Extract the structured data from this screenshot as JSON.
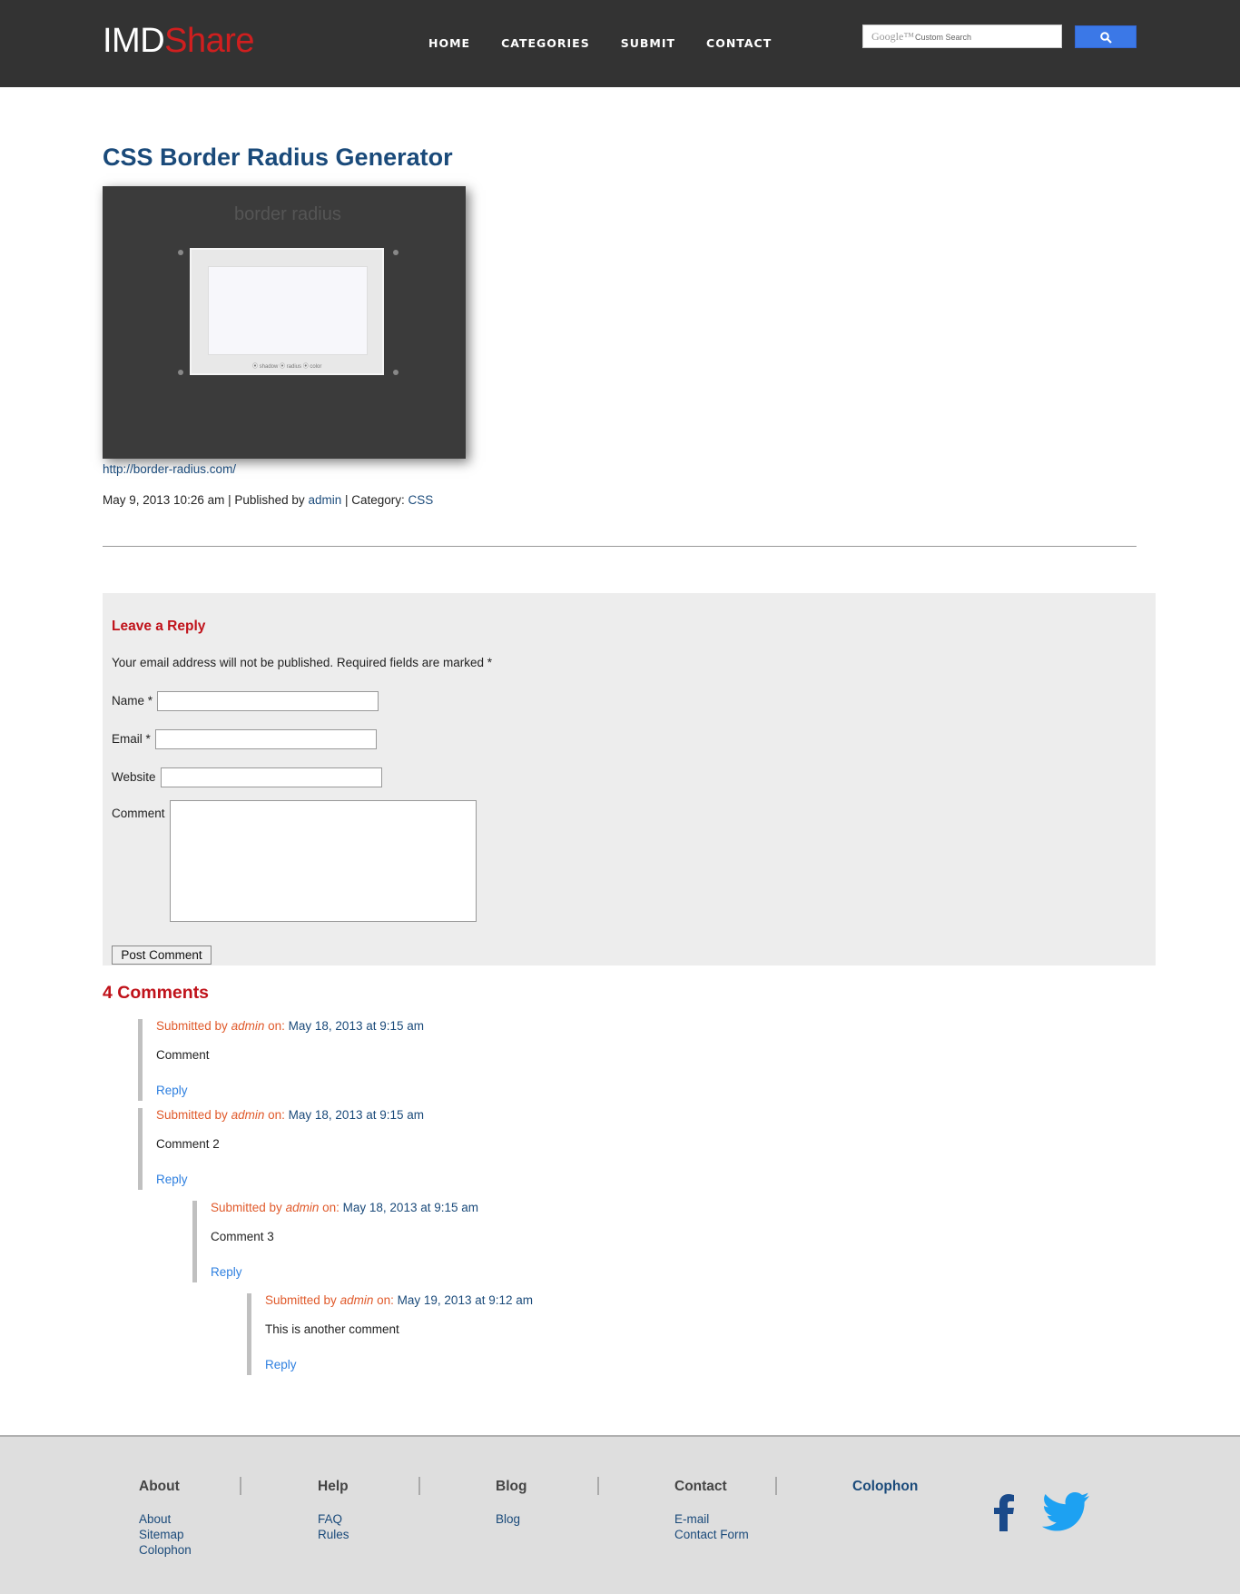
{
  "header": {
    "logo_part1": "IMD",
    "logo_part2": "Share",
    "nav": [
      "HOME",
      "CATEGORIES",
      "SUBMIT",
      "CONTACT"
    ],
    "search": {
      "google_label": "Google™",
      "placeholder": "Custom Search"
    }
  },
  "post": {
    "title": "CSS Border Radius Generator",
    "thumbnail_watermark": "border radius",
    "thumbnail_caption": "⦿ shadow ⦿ radius ⦿ color",
    "link": "http://border-radius.com/",
    "date": "May 9, 2013 10:26 am",
    "published_by_label": "| Published by",
    "author": "admin",
    "category_label": "| Category:",
    "category": "CSS"
  },
  "reply_form": {
    "title": "Leave a Reply",
    "note": "Your email address will not be published. Required fields are marked *",
    "name_label": "Name *",
    "email_label": "Email *",
    "website_label": "Website",
    "comment_label": "Comment",
    "submit": "Post Comment"
  },
  "comments": {
    "title": "4 Comments",
    "submitted_label": "Submitted by",
    "on_label": "on:",
    "reply_label": "Reply",
    "items": [
      {
        "author": "admin",
        "date": "May 18, 2013 at 9:15 am",
        "text": "Comment"
      },
      {
        "author": "admin",
        "date": "May 18, 2013 at 9:15 am",
        "text": "Comment 2"
      },
      {
        "author": "admin",
        "date": "May 18, 2013 at 9:15 am",
        "text": "Comment 3"
      },
      {
        "author": "admin",
        "date": "May 19, 2013 at 9:12 am",
        "text": "This is another comment"
      }
    ]
  },
  "footer": {
    "columns": [
      {
        "heading": "About",
        "links": [
          "About",
          "Sitemap",
          "Colophon"
        ]
      },
      {
        "heading": "Help",
        "links": [
          "FAQ",
          "Rules"
        ]
      },
      {
        "heading": "Blog",
        "links": [
          "Blog"
        ]
      },
      {
        "heading": "Contact",
        "links": [
          "E-mail",
          "Contact Form"
        ]
      },
      {
        "heading": "Colophon",
        "links": []
      }
    ],
    "social_icons": [
      "facebook-icon",
      "twitter-icon"
    ]
  },
  "colors": {
    "brand_red": "#d01f1f",
    "link_blue": "#1a4a7a",
    "comment_orange": "#e05a2b",
    "header_bg": "#333333"
  }
}
